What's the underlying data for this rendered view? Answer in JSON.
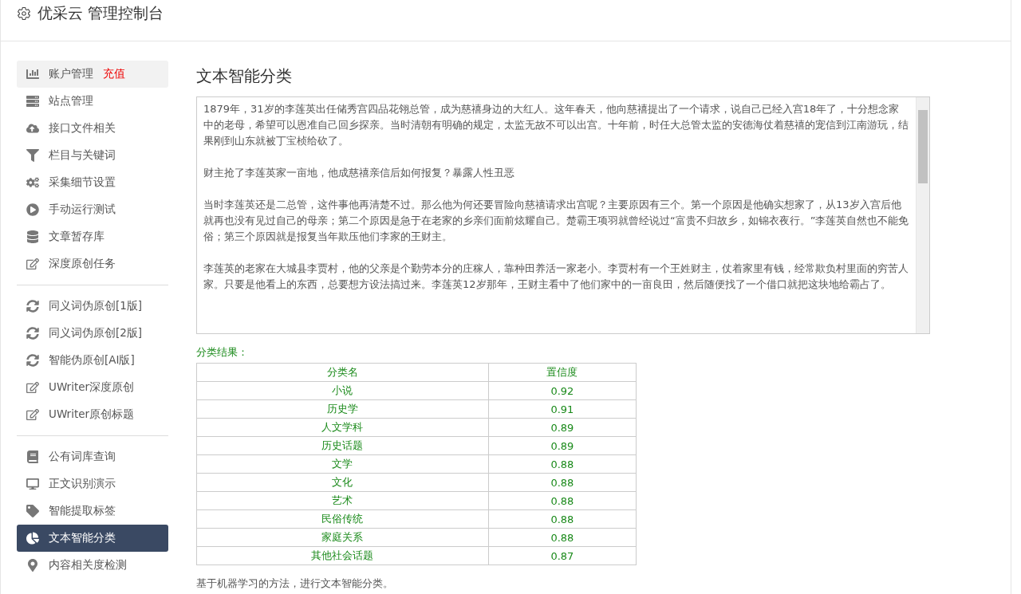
{
  "header": {
    "title": "优采云 管理控制台"
  },
  "sidebar": {
    "groups": [
      {
        "items": [
          {
            "label": "账户管理",
            "badge": "充值",
            "highlighted": true,
            "selected": false
          },
          {
            "label": "站点管理",
            "highlighted": false,
            "selected": false
          },
          {
            "label": "接口文件相关",
            "highlighted": false,
            "selected": false
          },
          {
            "label": "栏目与关键词",
            "highlighted": false,
            "selected": false
          },
          {
            "label": "采集细节设置",
            "highlighted": false,
            "selected": false
          },
          {
            "label": "手动运行测试",
            "highlighted": false,
            "selected": false
          },
          {
            "label": "文章暂存库",
            "highlighted": false,
            "selected": false
          },
          {
            "label": "深度原创任务",
            "highlighted": false,
            "selected": false
          }
        ]
      },
      {
        "items": [
          {
            "label": "同义词伪原创[1版]",
            "highlighted": false,
            "selected": false
          },
          {
            "label": "同义词伪原创[2版]",
            "highlighted": false,
            "selected": false
          },
          {
            "label": "智能伪原创[AI版]",
            "highlighted": false,
            "selected": false
          },
          {
            "label": "UWriter深度原创",
            "highlighted": false,
            "selected": false
          },
          {
            "label": "UWriter原创标题",
            "highlighted": false,
            "selected": false
          }
        ]
      },
      {
        "items": [
          {
            "label": "公有词库查询",
            "highlighted": false,
            "selected": false
          },
          {
            "label": "正文识别演示",
            "highlighted": false,
            "selected": false
          },
          {
            "label": "智能提取标签",
            "highlighted": false,
            "selected": false
          },
          {
            "label": "文本智能分类",
            "highlighted": false,
            "selected": true
          },
          {
            "label": "内容相关度检测",
            "highlighted": false,
            "selected": false
          }
        ]
      }
    ]
  },
  "main": {
    "title": "文本智能分类",
    "text_input": {
      "paragraphs": [
        "1879年，31岁的李莲英出任储秀宫四品花翎总管，成为慈禧身边的大红人。这年春天，他向慈禧提出了一个请求，说自己已经入宫18年了，十分想念家中的老母，希望可以恩准自己回乡探亲。当时清朝有明确的规定，太监无故不可以出宫。十年前，时任大总管太监的安德海仗着慈禧的宠信到江南游玩，结果刚到山东就被丁宝桢给砍了。",
        "财主抢了李莲英家一亩地，他成慈禧亲信后如何报复？暴露人性丑恶",
        "当时李莲英还是二总管，这件事他再清楚不过。那么他为何还要冒险向慈禧请求出宫呢？主要原因有三个。第一个原因是他确实想家了，从13岁入宫后他就再也没有见过自己的母亲；第二个原因是急于在老家的乡亲们面前炫耀自己。楚霸王项羽就曾经说过“富贵不归故乡，如锦衣夜行。”李莲英自然也不能免俗；第三个原因就是报复当年欺压他们李家的王财主。",
        "李莲英的老家在大城县李贾村，他的父亲是个勤劳本分的庄稼人，靠种田养活一家老小。李贾村有一个王姓财主，仗着家里有钱，经常欺负村里面的穷苦人家。只要是他看上的东西，总要想方设法搞过来。李莲英12岁那年，王财主看中了他们家中的一亩良田，然后随便找了一个借口就把这块地给霸占了。"
      ]
    },
    "result_label": "分类结果：",
    "table": {
      "columns": [
        "分类名",
        "置信度"
      ],
      "rows": [
        [
          "小说",
          "0.92"
        ],
        [
          "历史学",
          "0.91"
        ],
        [
          "人文学科",
          "0.89"
        ],
        [
          "历史话题",
          "0.89"
        ],
        [
          "文学",
          "0.88"
        ],
        [
          "文化",
          "0.88"
        ],
        [
          "艺术",
          "0.88"
        ],
        [
          "民俗传统",
          "0.88"
        ],
        [
          "家庭关系",
          "0.88"
        ],
        [
          "其他社会话题",
          "0.87"
        ]
      ]
    },
    "note": "基于机器学习的方法，进行文本智能分类。"
  }
}
